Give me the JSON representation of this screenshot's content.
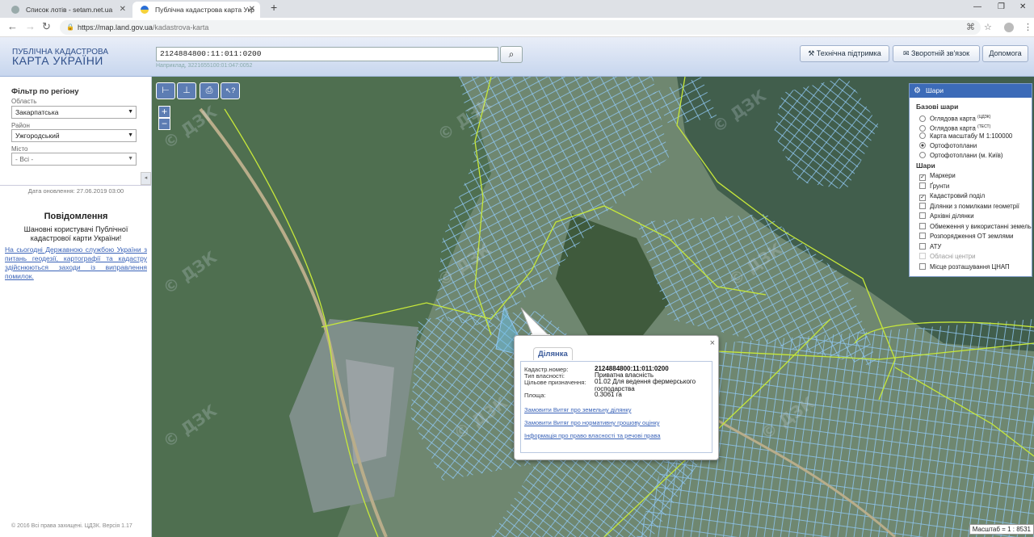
{
  "browser": {
    "tabs": [
      {
        "title": "Список лотів - setam.net.ua"
      },
      {
        "title": "Публічна кадастрова карта Укр"
      }
    ],
    "new_tab": "+",
    "window": {
      "minimize": "—",
      "restore": "❐",
      "close": "✕"
    },
    "nav": {
      "back": "←",
      "forward": "→",
      "reload": "↻"
    },
    "address": {
      "host": "https://map.land.gov.ua",
      "path": "/kadastrova-karta"
    }
  },
  "header": {
    "logo_line1": "ПУБЛІЧНА КАДАСТРОВА",
    "logo_line2": "КАРТА УКРАЇНИ",
    "search_value": "2124884800:11:011:0200",
    "search_hint": "Наприклад, 3221655100:01:047:0052",
    "buttons": {
      "support": "Технічна підтримка",
      "feedback": "Зворотній зв'язок",
      "help": "Допомога"
    }
  },
  "sidebar": {
    "filter_title": "Фільтр по регіону",
    "region_label": "Область",
    "region_value": "Закарпатська",
    "district_label": "Район",
    "district_value": "Ужгородський",
    "city_label": "Місто",
    "city_value": "- Всі -",
    "collapse": "◂",
    "updated": "Дата оновлення: 27.06.2019 03:00",
    "notice_title": "Повідомлення",
    "notice_body": "Шановні користувачі Публічної кадастрової карти України!",
    "notice_link": "На сьогодні Державною службою України з питань геодезії, картографії та кадастру здійснюються заходи із виправлення помилок.",
    "copyright": "© 2016 Всі права захищені. ЦДЗК. Версія 1.17"
  },
  "map": {
    "tools": {
      "measure_line": "⊢",
      "measure_area": "⊥",
      "print": "⎙",
      "identify": "↖?"
    },
    "zoom_in": "+",
    "zoom_out": "−",
    "scale_label": "Масштаб = 1 : 8531",
    "watermark": "© ДЗК",
    "colors": {
      "parcel": "#8fc6f0",
      "boundary": "#c7e83a",
      "panel_head": "#3c6bb8"
    }
  },
  "layers": {
    "title": "Шари",
    "base_title": "Базові шари",
    "base": [
      {
        "label": "Оглядова карта",
        "sup": "(ЦДЗК)",
        "selected": false
      },
      {
        "label": "Оглядова карта",
        "sup": "(ТЕСТ)",
        "selected": false
      },
      {
        "label": "Карта масштабу М 1:100000",
        "sup": "",
        "selected": false
      },
      {
        "label": "Ортофотоплани",
        "sup": "",
        "selected": true
      },
      {
        "label": "Ортофотоплани (м. Київ)",
        "sup": "",
        "selected": false
      }
    ],
    "layers_title": "Шари",
    "items": [
      {
        "label": "Маркери",
        "checked": true,
        "disabled": false
      },
      {
        "label": "Ґрунти",
        "checked": false,
        "disabled": false
      },
      {
        "label": "Кадастровий поділ",
        "checked": true,
        "disabled": false
      },
      {
        "label": "Ділянки з помилками геометрії",
        "checked": false,
        "disabled": false
      },
      {
        "label": "Архівні ділянки",
        "checked": false,
        "disabled": false
      },
      {
        "label": "Обмеження у використанні земель",
        "checked": false,
        "disabled": false
      },
      {
        "label": "Розпорядження ОТ землями",
        "checked": false,
        "disabled": false
      },
      {
        "label": "АТУ",
        "checked": false,
        "disabled": false
      },
      {
        "label": "Обласні центри",
        "checked": false,
        "disabled": true
      },
      {
        "label": "Місце розташування ЦНАП",
        "checked": false,
        "disabled": false
      }
    ]
  },
  "popup": {
    "tab": "Ділянка",
    "close": "×",
    "rows": [
      {
        "label": "Кадастр.номер:",
        "value": "2124884800:11:011:0200"
      },
      {
        "label": "Тип власності:",
        "value": "Приватна власність"
      },
      {
        "label": "Цільове призначення:",
        "value": "01.02 Для ведення фермерського господарства"
      },
      {
        "label": "Площа:",
        "value": "0.3061 га"
      }
    ],
    "links": [
      "Замовити Витяг про земельну ділянку",
      "Замовити Витяг про нормативну грошову оцінку",
      "Інформація про право власності та речові права"
    ]
  }
}
